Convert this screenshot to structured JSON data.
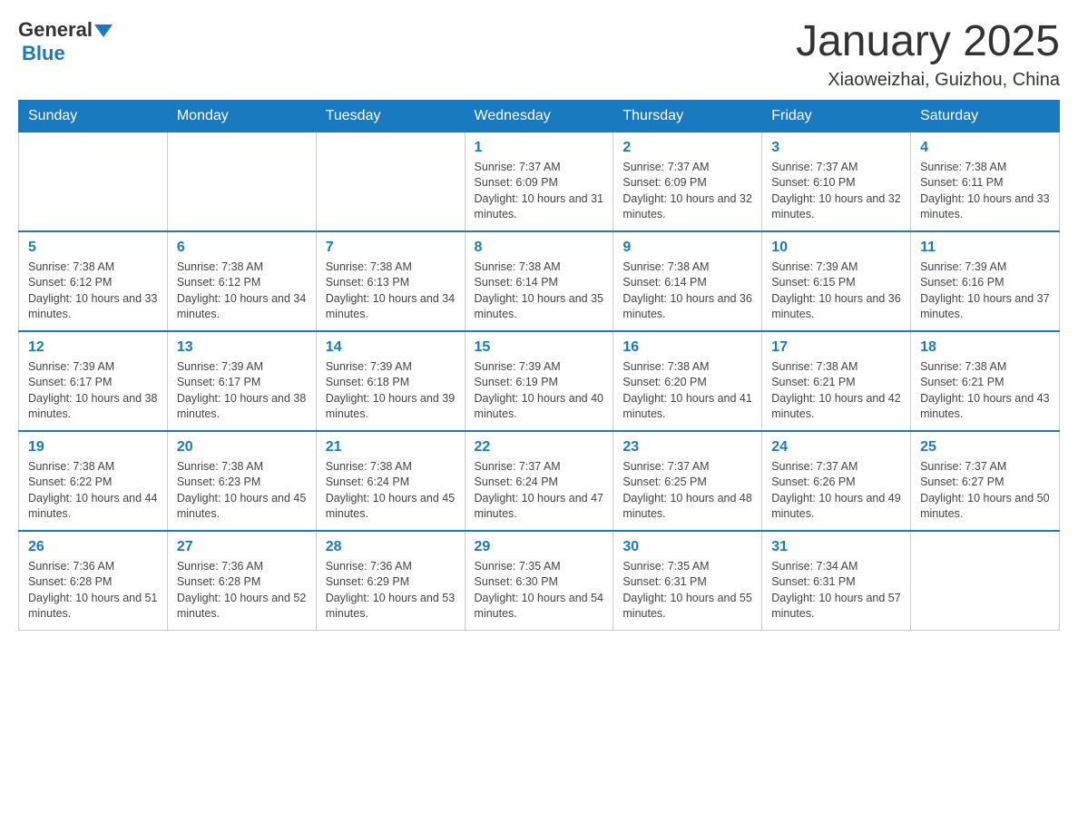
{
  "header": {
    "logo_general": "General",
    "logo_blue": "Blue",
    "title": "January 2025",
    "subtitle": "Xiaoweizhai, Guizhou, China"
  },
  "days_of_week": [
    "Sunday",
    "Monday",
    "Tuesday",
    "Wednesday",
    "Thursday",
    "Friday",
    "Saturday"
  ],
  "weeks": [
    [
      {
        "day": "",
        "info": ""
      },
      {
        "day": "",
        "info": ""
      },
      {
        "day": "",
        "info": ""
      },
      {
        "day": "1",
        "info": "Sunrise: 7:37 AM\nSunset: 6:09 PM\nDaylight: 10 hours and 31 minutes."
      },
      {
        "day": "2",
        "info": "Sunrise: 7:37 AM\nSunset: 6:09 PM\nDaylight: 10 hours and 32 minutes."
      },
      {
        "day": "3",
        "info": "Sunrise: 7:37 AM\nSunset: 6:10 PM\nDaylight: 10 hours and 32 minutes."
      },
      {
        "day": "4",
        "info": "Sunrise: 7:38 AM\nSunset: 6:11 PM\nDaylight: 10 hours and 33 minutes."
      }
    ],
    [
      {
        "day": "5",
        "info": "Sunrise: 7:38 AM\nSunset: 6:12 PM\nDaylight: 10 hours and 33 minutes."
      },
      {
        "day": "6",
        "info": "Sunrise: 7:38 AM\nSunset: 6:12 PM\nDaylight: 10 hours and 34 minutes."
      },
      {
        "day": "7",
        "info": "Sunrise: 7:38 AM\nSunset: 6:13 PM\nDaylight: 10 hours and 34 minutes."
      },
      {
        "day": "8",
        "info": "Sunrise: 7:38 AM\nSunset: 6:14 PM\nDaylight: 10 hours and 35 minutes."
      },
      {
        "day": "9",
        "info": "Sunrise: 7:38 AM\nSunset: 6:14 PM\nDaylight: 10 hours and 36 minutes."
      },
      {
        "day": "10",
        "info": "Sunrise: 7:39 AM\nSunset: 6:15 PM\nDaylight: 10 hours and 36 minutes."
      },
      {
        "day": "11",
        "info": "Sunrise: 7:39 AM\nSunset: 6:16 PM\nDaylight: 10 hours and 37 minutes."
      }
    ],
    [
      {
        "day": "12",
        "info": "Sunrise: 7:39 AM\nSunset: 6:17 PM\nDaylight: 10 hours and 38 minutes."
      },
      {
        "day": "13",
        "info": "Sunrise: 7:39 AM\nSunset: 6:17 PM\nDaylight: 10 hours and 38 minutes."
      },
      {
        "day": "14",
        "info": "Sunrise: 7:39 AM\nSunset: 6:18 PM\nDaylight: 10 hours and 39 minutes."
      },
      {
        "day": "15",
        "info": "Sunrise: 7:39 AM\nSunset: 6:19 PM\nDaylight: 10 hours and 40 minutes."
      },
      {
        "day": "16",
        "info": "Sunrise: 7:38 AM\nSunset: 6:20 PM\nDaylight: 10 hours and 41 minutes."
      },
      {
        "day": "17",
        "info": "Sunrise: 7:38 AM\nSunset: 6:21 PM\nDaylight: 10 hours and 42 minutes."
      },
      {
        "day": "18",
        "info": "Sunrise: 7:38 AM\nSunset: 6:21 PM\nDaylight: 10 hours and 43 minutes."
      }
    ],
    [
      {
        "day": "19",
        "info": "Sunrise: 7:38 AM\nSunset: 6:22 PM\nDaylight: 10 hours and 44 minutes."
      },
      {
        "day": "20",
        "info": "Sunrise: 7:38 AM\nSunset: 6:23 PM\nDaylight: 10 hours and 45 minutes."
      },
      {
        "day": "21",
        "info": "Sunrise: 7:38 AM\nSunset: 6:24 PM\nDaylight: 10 hours and 45 minutes."
      },
      {
        "day": "22",
        "info": "Sunrise: 7:37 AM\nSunset: 6:24 PM\nDaylight: 10 hours and 47 minutes."
      },
      {
        "day": "23",
        "info": "Sunrise: 7:37 AM\nSunset: 6:25 PM\nDaylight: 10 hours and 48 minutes."
      },
      {
        "day": "24",
        "info": "Sunrise: 7:37 AM\nSunset: 6:26 PM\nDaylight: 10 hours and 49 minutes."
      },
      {
        "day": "25",
        "info": "Sunrise: 7:37 AM\nSunset: 6:27 PM\nDaylight: 10 hours and 50 minutes."
      }
    ],
    [
      {
        "day": "26",
        "info": "Sunrise: 7:36 AM\nSunset: 6:28 PM\nDaylight: 10 hours and 51 minutes."
      },
      {
        "day": "27",
        "info": "Sunrise: 7:36 AM\nSunset: 6:28 PM\nDaylight: 10 hours and 52 minutes."
      },
      {
        "day": "28",
        "info": "Sunrise: 7:36 AM\nSunset: 6:29 PM\nDaylight: 10 hours and 53 minutes."
      },
      {
        "day": "29",
        "info": "Sunrise: 7:35 AM\nSunset: 6:30 PM\nDaylight: 10 hours and 54 minutes."
      },
      {
        "day": "30",
        "info": "Sunrise: 7:35 AM\nSunset: 6:31 PM\nDaylight: 10 hours and 55 minutes."
      },
      {
        "day": "31",
        "info": "Sunrise: 7:34 AM\nSunset: 6:31 PM\nDaylight: 10 hours and 57 minutes."
      },
      {
        "day": "",
        "info": ""
      }
    ]
  ]
}
